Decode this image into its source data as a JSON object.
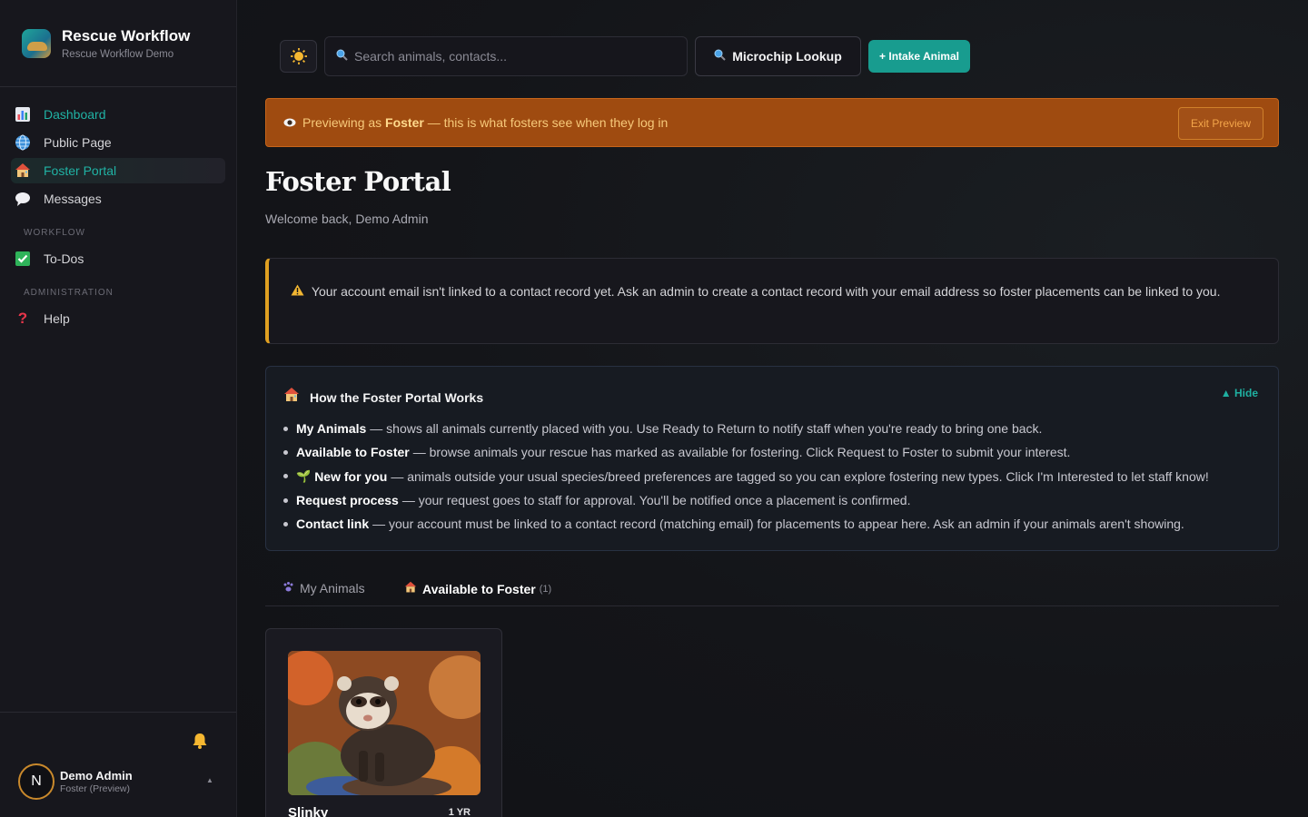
{
  "brand": {
    "title": "Rescue Workflow",
    "subtitle": "Rescue Workflow Demo"
  },
  "sidebar": {
    "items": [
      {
        "label": "Dashboard",
        "icon": "bar-chart-icon"
      },
      {
        "label": "Public Page",
        "icon": "globe-icon"
      },
      {
        "label": "Foster Portal",
        "icon": "house-icon",
        "active": true
      },
      {
        "label": "Messages",
        "icon": "speech-bubble-icon"
      }
    ],
    "workflow_label": "WORKFLOW",
    "workflow_items": [
      {
        "label": "To-Dos",
        "icon": "checkbox-icon"
      }
    ],
    "admin_label": "ADMINISTRATION",
    "admin_items": [
      {
        "label": "Help",
        "icon": "question-icon"
      }
    ]
  },
  "user": {
    "initial": "N",
    "name": "Demo Admin",
    "role": "Foster (Preview)"
  },
  "topbar": {
    "search_placeholder": "Search animals, contacts...",
    "microchip_label": "Microchip Lookup",
    "intake_label": "+ Intake Animal"
  },
  "preview_banner": {
    "prefix": "Previewing as ",
    "role": "Foster",
    "suffix": " — this is what fosters see when they log in",
    "exit_label": "Exit Preview"
  },
  "page": {
    "title": "Foster Portal",
    "subtitle": "Welcome back, Demo Admin"
  },
  "warning": {
    "text": "Your account email isn't linked to a contact record yet. Ask an admin to create a contact record with your email address so foster placements can be linked to you."
  },
  "info": {
    "title": "How the Foster Portal Works",
    "hide_label": "▲ Hide",
    "items": [
      {
        "term": "My Animals",
        "desc": "— shows all animals currently placed with you. Use Ready to Return to notify staff when you're ready to bring one back."
      },
      {
        "term": "Available to Foster",
        "desc": "— browse animals your rescue has marked as available for fostering. Click Request to Foster to submit your interest."
      },
      {
        "term": "New for you",
        "desc": "— animals outside your usual species/breed preferences are tagged so you can explore fostering new types. Click I'm Interested to let staff know!"
      },
      {
        "term": "Request process",
        "desc": "— your request goes to staff for approval. You'll be notified once a placement is confirmed."
      },
      {
        "term": "Contact link",
        "desc": "— your account must be linked to a contact record (matching email) for placements to appear here. Ask an admin if your animals aren't showing."
      }
    ]
  },
  "tabs": [
    {
      "label": "My Animals"
    },
    {
      "label": "Available to Foster",
      "count": "(1)",
      "active": true
    }
  ],
  "animals": [
    {
      "name": "Slinky",
      "age": "1 YR"
    }
  ],
  "colors": {
    "accent": "#20b2a4",
    "banner": "#9f4b10",
    "warning": "#e0a021"
  }
}
